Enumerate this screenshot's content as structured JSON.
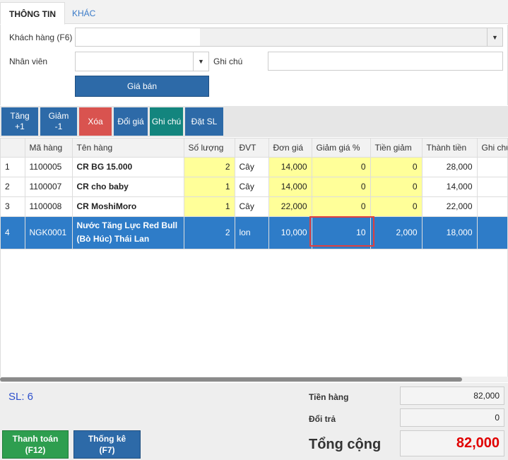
{
  "tabs": {
    "info": "THÔNG TIN",
    "other": "KHÁC"
  },
  "form": {
    "customer_label": "Khách hàng (F6)",
    "customer_value": "",
    "employee_label": "Nhân viên",
    "employee_value": "",
    "note_label": "Ghi chú",
    "note_value": "",
    "price_button": "Giá bán"
  },
  "toolbar": {
    "increase": "Tăng +1",
    "decrease": "Giảm -1",
    "delete": "Xóa",
    "change_price": "Đổi giá",
    "note": "Ghi chú",
    "set_qty": "Đặt SL"
  },
  "table": {
    "headers": [
      "",
      "Mã hàng",
      "Tên hàng",
      "Số lượng",
      "ĐVT",
      "Đơn giá",
      "Giảm giá %",
      "Tiền giảm",
      "Thành tiền",
      "Ghi chú"
    ],
    "rows": [
      {
        "no": "1",
        "code": "1100005",
        "name": "CR BG 15.000",
        "qty": "2",
        "unit": "Cây",
        "price": "14,000",
        "disc_pct": "0",
        "disc_amt": "0",
        "total": "28,000",
        "note": ""
      },
      {
        "no": "2",
        "code": "1100007",
        "name": "CR cho baby",
        "qty": "1",
        "unit": "Cây",
        "price": "14,000",
        "disc_pct": "0",
        "disc_amt": "0",
        "total": "14,000",
        "note": ""
      },
      {
        "no": "3",
        "code": "1100008",
        "name": "CR MoshiMoro",
        "qty": "1",
        "unit": "Cây",
        "price": "22,000",
        "disc_pct": "0",
        "disc_amt": "0",
        "total": "22,000",
        "note": ""
      },
      {
        "no": "4",
        "code": "NGK0001",
        "name": "Nước Tăng Lực Red Bull (Bò Húc) Thái Lan",
        "qty": "2",
        "unit": "lon",
        "price": "10,000",
        "disc_pct": "10",
        "disc_amt": "2,000",
        "total": "18,000",
        "note": ""
      }
    ]
  },
  "footer": {
    "count": "SL: 6",
    "subtotal_label": "Tiền hàng",
    "subtotal_value": "82,000",
    "return_label": "Đổi trả",
    "return_value": "0",
    "total_label": "Tổng cộng",
    "total_value": "82,000",
    "pay_button_line1": "Thanh toán",
    "pay_button_line2": "(F12)",
    "stats_button_line1": "Thống kê",
    "stats_button_line2": "(F7)"
  },
  "colors": {
    "primary": "#2d6aa8",
    "selected_row": "#2e7cc8",
    "danger": "#d9534f",
    "teal": "#13857e",
    "green": "#2e9e4f",
    "highlight": "#ffff99",
    "total_red": "#e00000"
  }
}
